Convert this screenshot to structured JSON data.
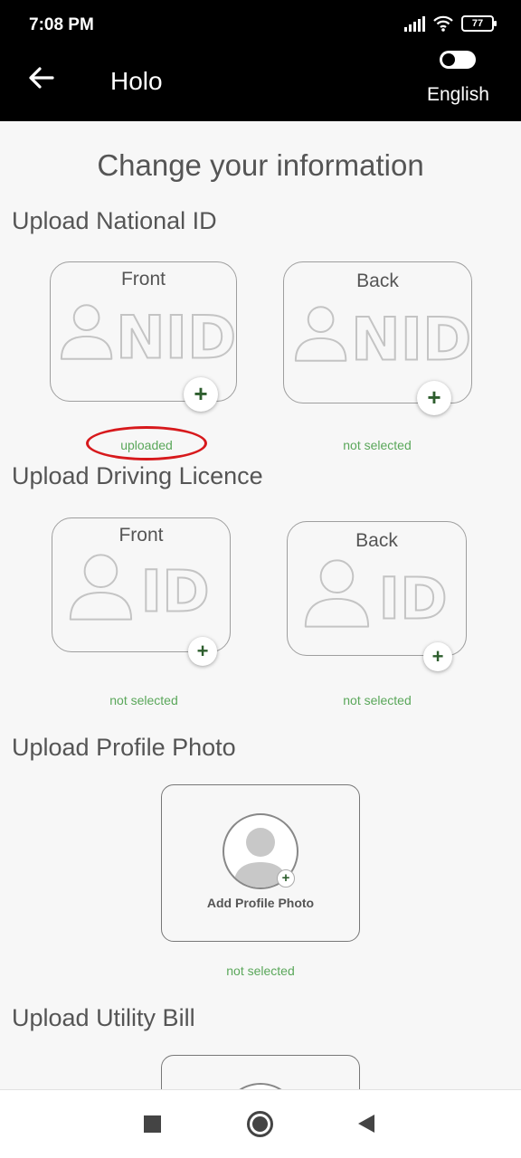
{
  "status_bar": {
    "time": "7:08 PM",
    "battery": "77"
  },
  "app_bar": {
    "title": "Holo",
    "language": "English"
  },
  "page_title": "Change your information",
  "national_id": {
    "title": "Upload National ID",
    "front": {
      "label": "Front",
      "graphic_text": "NID",
      "status": "uploaded"
    },
    "back": {
      "label": "Back",
      "graphic_text": "NID",
      "status": "not selected"
    }
  },
  "driving_licence": {
    "title": "Upload Driving Licence",
    "front": {
      "label": "Front",
      "graphic_text": "ID",
      "status": "not selected"
    },
    "back": {
      "label": "Back",
      "graphic_text": "ID",
      "status": "not selected"
    }
  },
  "profile_photo": {
    "title": "Upload Profile Photo",
    "button_label": "Add Profile Photo",
    "status": "not selected"
  },
  "utility_bill": {
    "title": "Upload Utility Bill"
  },
  "colors": {
    "accent_green": "#5aa75a",
    "plus_green": "#2e5e2e",
    "highlight_red": "#d7191c"
  },
  "icons": [
    "back-arrow-icon",
    "wifi-icon",
    "signal-icon",
    "battery-icon",
    "toggle-icon",
    "person-icon",
    "plus-icon",
    "nav-recents-icon",
    "nav-home-icon",
    "nav-back-icon"
  ]
}
